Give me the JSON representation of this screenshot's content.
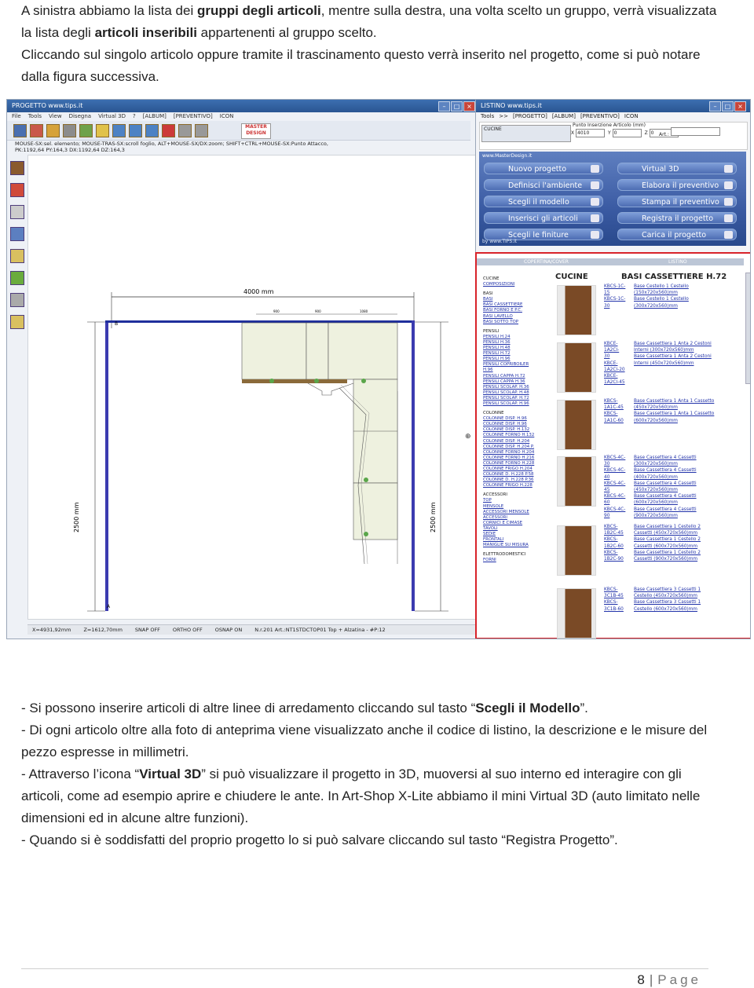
{
  "intro": {
    "p1_a": "A sinistra abbiamo la lista dei ",
    "p1_b": "gruppi degli articoli",
    "p1_c": ", mentre sulla destra, una volta scelto un gruppo, verrà visualizzata la lista degli ",
    "p1_d": "articoli inseribili",
    "p1_e": " appartenenti al gruppo scelto.",
    "p2": "Cliccando sul singolo articolo oppure tramite il trascinamento questo verrà inserito nel progetto, come si può notare dalla figura successiva."
  },
  "left_window": {
    "title": "PROGETTO  www.tips.it",
    "menu": [
      "File",
      "Tools",
      "View",
      "Disegna",
      "Virtual 3D",
      "?",
      "[ALBUM]",
      "[PREVENTIVO]",
      "ICON"
    ],
    "logo": "MASTER DESIGN",
    "status_line1": "MOUSE-SX:sel. elemento; MOUSE-TRAS-SX:scroll foglio, ALT+MOUSE-SX/DX:zoom; SHIFT+CTRL+MOUSE-SX:Punto Attacco,",
    "status_line2": "PK:1192,64 PY:164,3  DX:1192,64 DZ:164,3",
    "drawing": {
      "dim_top": "4000 mm",
      "dim_left": "2500 mm",
      "dim_right": "2500 mm",
      "wall_b": "B",
      "wall_a": "A",
      "seg1": "900",
      "seg2": "900",
      "seg3": "1080"
    },
    "statusbar": [
      "X=4931,92mm",
      "Z=1612,70mm",
      "SNAP OFF",
      "ORTHO OFF",
      "OSNAP ON",
      "N.r.201 Art.:NT1STDCTOP01 Top + Alzatina - #P:12"
    ]
  },
  "right_window": {
    "title": "LISTINO  www.tips.it",
    "menu": [
      "Tools",
      ">>",
      "[PROGETTO]",
      "[ALBUM]",
      "[PREVENTIVO]",
      "ICON"
    ],
    "chip": "CUCINE",
    "insertion_title": "Punto Inserzione Articolo (mm)",
    "field_labels": [
      "X",
      "Y",
      "Z"
    ],
    "field_values": [
      "4010",
      "0",
      "0"
    ],
    "art_label": "Art.:",
    "url": "www.MasterDesign.it",
    "nav": [
      "Nuovo progetto",
      "Definisci l'ambiente",
      "Scegli il modello",
      "Inserisci gli articoli",
      "Scegli le finiture",
      "Virtual 3D",
      "Elabora il preventivo",
      "Stampa il preventivo",
      "Registra il progetto",
      "Carica il progetto"
    ],
    "nav_foot": "by www.TIPS.it"
  },
  "catalog": {
    "tabs": [
      "COPERTINA/COVER",
      "LISTINO"
    ],
    "groups": [
      {
        "t": "h",
        "v": "CUCINE"
      },
      {
        "t": "g",
        "v": "COMPOSIZIONI"
      },
      {
        "t": "h",
        "v": "BASI"
      },
      {
        "t": "g",
        "v": "BASI"
      },
      {
        "t": "g",
        "v": "BASI CASSETTIERE"
      },
      {
        "t": "g",
        "v": "BASI FORNO E P.C."
      },
      {
        "t": "g",
        "v": "BASI LAVELLO"
      },
      {
        "t": "g",
        "v": "BASI SOTTO TOP"
      },
      {
        "t": "h",
        "v": "PENSILI"
      },
      {
        "t": "g",
        "v": "PENSILI H.24"
      },
      {
        "t": "g",
        "v": "PENSILI H.36"
      },
      {
        "t": "g",
        "v": "PENSILI H.48"
      },
      {
        "t": "g",
        "v": "PENSILI H.72"
      },
      {
        "t": "g",
        "v": "PENSILI H.96"
      },
      {
        "t": "g",
        "v": "PENSILI COPRIBOILER"
      },
      {
        "t": "g",
        "v": "H.96"
      },
      {
        "t": "g",
        "v": "PENSILI CAPPA H.72"
      },
      {
        "t": "g",
        "v": "PENSILI CAPPA H.36"
      },
      {
        "t": "g",
        "v": "PENSILI SCOLAP. H.36"
      },
      {
        "t": "g",
        "v": "PENSILI SCOLAP. H.48"
      },
      {
        "t": "g",
        "v": "PENSILI SCOLAP. H.72"
      },
      {
        "t": "g",
        "v": "PENSILI SCOLAP. H.96"
      },
      {
        "t": "h",
        "v": "COLONNE"
      },
      {
        "t": "g",
        "v": "COLONNE DISP. H.96"
      },
      {
        "t": "g",
        "v": "COLONNE DISP. H.96"
      },
      {
        "t": "g",
        "v": "COLONNE DISP. H.132"
      },
      {
        "t": "g",
        "v": "COLONNE FORNO H.132"
      },
      {
        "t": "g",
        "v": "COLONNE DISP. H.204"
      },
      {
        "t": "g",
        "v": "COLONNE DISP. H.204 P."
      },
      {
        "t": "g",
        "v": "COLONNE FORNO H.204"
      },
      {
        "t": "g",
        "v": "COLONNE FORNO H.216"
      },
      {
        "t": "g",
        "v": "COLONNE FORNO H.228"
      },
      {
        "t": "g",
        "v": "COLONNE FRIGO H.204"
      },
      {
        "t": "g",
        "v": "COLONNE D. H.228 P.58"
      },
      {
        "t": "g",
        "v": "COLONNE D. H.228 P.36"
      },
      {
        "t": "g",
        "v": "COLONNE FRIGO H.228"
      },
      {
        "t": "h",
        "v": "ACCESSORI"
      },
      {
        "t": "g",
        "v": "TOP"
      },
      {
        "t": "g",
        "v": "MENSOLE"
      },
      {
        "t": "g",
        "v": "ACCESSORI MENSOLE"
      },
      {
        "t": "g",
        "v": "ACCESSORI"
      },
      {
        "t": "g",
        "v": "CORNICI E CIMASE"
      },
      {
        "t": "g",
        "v": "TAVOLI"
      },
      {
        "t": "g",
        "v": "SEDIE"
      },
      {
        "t": "g",
        "v": "FRONTALI"
      },
      {
        "t": "g",
        "v": "MANIGLIE SU MISURA"
      },
      {
        "t": "h",
        "v": "ELETTRODOMESTICI"
      },
      {
        "t": "g",
        "v": "FORNI"
      }
    ],
    "selected_group": "CUCINE",
    "selected_subgroup": "BASI CASSETTIERE H.72",
    "articles": [
      {
        "codes": [
          "KBCS-1C-",
          "15",
          "KBCS-1C-",
          "30"
        ],
        "descs": [
          "Base Cestello 1 Cestello",
          "(150x720x560)mm",
          "Base Cestello 1 Cestello",
          "(300x720x560)mm"
        ]
      },
      {
        "codes": [
          "KBCE-",
          "1A2CI-",
          "30",
          "KBCE-",
          "1A2CI-20",
          "KBCE-",
          "1A2CI-45"
        ],
        "descs": [
          "Base Cassettiera 1 Anta 2 Cestoni",
          "Interni (300x720x560)mm",
          "Base Cassettiera 1 Anta 2 Cestoni",
          "Interni (450x720x560)mm"
        ]
      },
      {
        "codes": [
          "KBCS-",
          "1A1C-45",
          "KBCS-",
          "1A1C-60"
        ],
        "descs": [
          "Base Cassettiera 1 Anta 1 Cassetto",
          "(450x720x560)mm",
          "Base Cassettiera 1 Anta 1 Cassetto",
          "(600x720x560)mm"
        ]
      },
      {
        "codes": [
          "KBCS-4C-",
          "30",
          "KBCS-4C-",
          "40",
          "KBCS-4C-",
          "45",
          "KBCS-4C-",
          "60",
          "KBCS-4C-",
          "90"
        ],
        "descs": [
          "Base Cassettiera 4 Cassetti",
          "(300x720x560)mm",
          "Base Cassettiera 4 Cassetti",
          "(400x720x560)mm",
          "Base Cassettiera 4 Cassetti",
          "(450x720x560)mm",
          "Base Cassettiera 4 Cassetti",
          "(600x720x560)mm",
          "Base Cassettiera 4 Cassetti",
          "(900x720x560)mm"
        ]
      },
      {
        "codes": [
          "KBCS-",
          "1B2C-45",
          "KBCS-",
          "1B2C-60",
          "KBCS-",
          "1B2C-90"
        ],
        "descs": [
          "Base Cassettiera 1 Cestello 2",
          "Cassetti (450x720x560)mm",
          "Base Cassettiera 1 Cestello 2",
          "Cassetti (600x720x560)mm",
          "Base Cassettiera 1 Cestello 2",
          "Cassetti (900x720x560)mm"
        ]
      },
      {
        "codes": [
          "KBCS-",
          "3C1B-45",
          "KBCS-",
          "3C1B-60"
        ],
        "descs": [
          "Base Cassettiera 3 Cassetti 1",
          "Cestello (450x720x560)mm",
          "Base Cassettiera 3 Cassetti 1",
          "Cestello (600x720x560)mm"
        ]
      }
    ]
  },
  "bullets": [
    {
      "a": "- Si possono inserire articoli di altre linee di arredamento cliccando sul tasto “",
      "b": "Scegli il Modello",
      "c": "”."
    },
    {
      "a": "- Di ogni articolo oltre alla foto di anteprima viene visualizzato anche il codice di listino, la descrizione e le misure del pezzo espresse in millimetri.",
      "b": "",
      "c": ""
    },
    {
      "a": "- Attraverso l’icona “",
      "b": "Virtual 3D",
      "c": "” si può visualizzare il progetto in 3D, muoversi al suo interno ed interagire con gli articoli, come ad esempio aprire e chiudere le ante. In Art-Shop X-Lite abbiamo il mini Virtual 3D (auto limitato nelle dimensioni ed in alcune altre funzioni)."
    },
    {
      "a": "- Quando si è soddisfatti del proprio progetto lo si può salvare cliccando sul tasto “Registra Progetto”.",
      "b": "",
      "c": ""
    }
  ],
  "footer": {
    "page_number": "8",
    "separator": "|",
    "page_word": "Page"
  }
}
